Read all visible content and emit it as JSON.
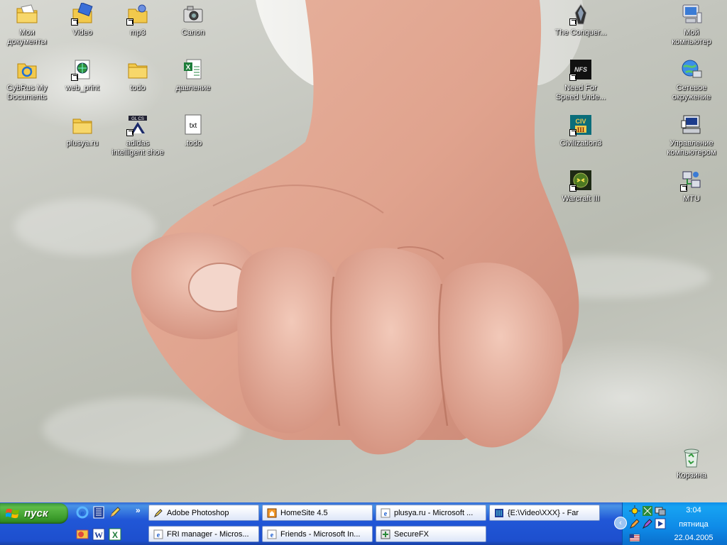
{
  "desktop": {
    "icons_left": [
      {
        "label": "Мои документы",
        "icon": "my-documents-folder-icon"
      },
      {
        "label": "Video",
        "icon": "video-shortcut-icon"
      },
      {
        "label": "mp3",
        "icon": "mp3-folder-shortcut-icon"
      },
      {
        "label": "Canon",
        "icon": "camera-icon"
      },
      {
        "label": "CybRus My Documents",
        "icon": "sync-folder-icon"
      },
      {
        "label": "web_print",
        "icon": "web-print-shortcut-icon"
      },
      {
        "label": "todo",
        "icon": "folder-icon"
      },
      {
        "label": "давление",
        "icon": "excel-file-icon"
      },
      {
        "label": "plusya.ru",
        "icon": "folder-icon"
      },
      {
        "label": "adidas intelligent shoe",
        "icon": "adidas-shortcut-icon"
      },
      {
        "label": ".todo",
        "icon": "txt-file-icon"
      }
    ],
    "icons_right": [
      {
        "label": "The Conquer...",
        "icon": "game-shortcut-icon"
      },
      {
        "label": "Мой компьютер",
        "icon": "my-computer-icon"
      },
      {
        "label": "Need For Speed Unde...",
        "icon": "nfs-shortcut-icon"
      },
      {
        "label": "Сетевое окружение",
        "icon": "network-places-icon"
      },
      {
        "label": "Civilization3",
        "icon": "civ3-shortcut-icon"
      },
      {
        "label": "Управление компьютером",
        "icon": "computer-management-icon"
      },
      {
        "label": "Warcraft III",
        "icon": "warcraft-shortcut-icon"
      },
      {
        "label": "MTU",
        "icon": "mtu-shortcut-icon"
      },
      {
        "label": "Корзина",
        "icon": "recycle-bin-icon"
      }
    ]
  },
  "taskbar": {
    "start_label": "пуск",
    "quick_launch": [
      "ie-icon",
      "windows-media-icon",
      "pencil-icon",
      "outlook-icon",
      "word-icon",
      "excel-icon"
    ],
    "overflow": "»",
    "tasks": [
      {
        "label": "Adobe Photoshop",
        "icon": "photoshop-icon"
      },
      {
        "label": "HomeSite 4.5",
        "icon": "homesite-icon"
      },
      {
        "label": "plusya.ru - Microsoft ...",
        "icon": "ie-icon"
      },
      {
        "label": "{E:\\Video\\XXX} - Far",
        "icon": "far-icon"
      },
      {
        "label": "FRI manager - Micros...",
        "icon": "ie-icon"
      },
      {
        "label": "Friends - Microsoft In...",
        "icon": "ie-icon"
      },
      {
        "label": "SecureFX",
        "icon": "securefx-icon"
      }
    ],
    "tray": {
      "collapse": "‹",
      "time": "3:04",
      "day": "пятница",
      "date": "22.04.2005",
      "language": "EN"
    }
  }
}
